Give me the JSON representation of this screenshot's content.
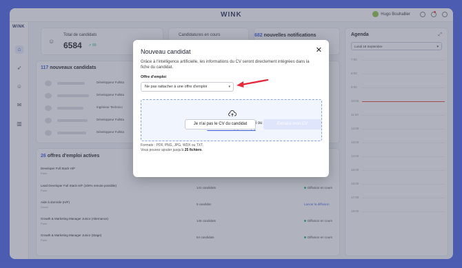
{
  "app": {
    "logo": "WINK",
    "user_name": "Hugo Bouhallier"
  },
  "dashboard": {
    "total_candidates_label": "Total de candidats",
    "total_candidates_value": "6584",
    "total_candidates_trend": "89",
    "applications_label": "Candidatures en cours",
    "notifications_count": "682",
    "notifications_label": "nouvelles notifications",
    "new_candidates_count": "117",
    "new_candidates_label": "nouveaux candidats",
    "new_candidates_roles": [
      "Développeur Fullsta",
      "Développeur Fullsta",
      "Ingénieur Technico",
      "Développeur Fullsta",
      "Développeur Fullsta"
    ],
    "job_offers_count": "26",
    "job_offers_label": "offres d'emploi actives",
    "jobs": [
      {
        "title": "Developer Full Stack H/F",
        "location": "Paris",
        "count": "",
        "status": ""
      },
      {
        "title": "Lead Developer Full Stack H/F (100% remote possible)",
        "location": "Paris",
        "count": "141 candidats",
        "status": "Diffusion en cours"
      },
      {
        "title": "Aide à domicile (H/F)",
        "location": "Douai",
        "count": "5 candidat",
        "status": "Lancer la diffusion"
      },
      {
        "title": "Growth & Marketing Manager Junior (Alternance)",
        "location": "Paris",
        "count": "145 candidats",
        "status": "Diffusion en cours"
      },
      {
        "title": "Growth & Marketing Manager Junior (Stage)",
        "location": "Paris",
        "count": "64 candidats",
        "status": "Diffusion en cours"
      }
    ]
  },
  "agenda": {
    "title": "Agenda",
    "date": "Lundi 18 Septembre",
    "hours": [
      "7:00",
      "8:00",
      "9:00",
      "10:00",
      "11:00",
      "12:00",
      "13:00",
      "14:00",
      "15:00",
      "16:00",
      "17:00",
      "18:00"
    ]
  },
  "modal": {
    "title": "Nouveau candidat",
    "close": "✕",
    "description": "Grâce à l'intelligence artificielle, les informations du CV seront directement intégrées dans la fiche du candidat.",
    "field_label": "Offre d'emploi",
    "select_value": "Ne pas rattacher à une offre d'emploi",
    "dropzone_text": "Glissez et déposez le(s) CV ici ou",
    "dropzone_link": "sélectionner le(s) fichier(s)",
    "formats_text": "Formats : PDF, PNG, JPG, WDX ou TXT.",
    "limit_prefix": "Vous pouvez ajouter jusqu'à",
    "limit_value": "25 fichiers",
    "limit_suffix": ".",
    "no_cv_button": "Je n'ai pas le CV du candidat",
    "submit_button": "Extraire mon CV"
  },
  "colors": {
    "background": "#4a63e8",
    "accent": "#3b5bdb",
    "arrow": "#e8283a"
  }
}
